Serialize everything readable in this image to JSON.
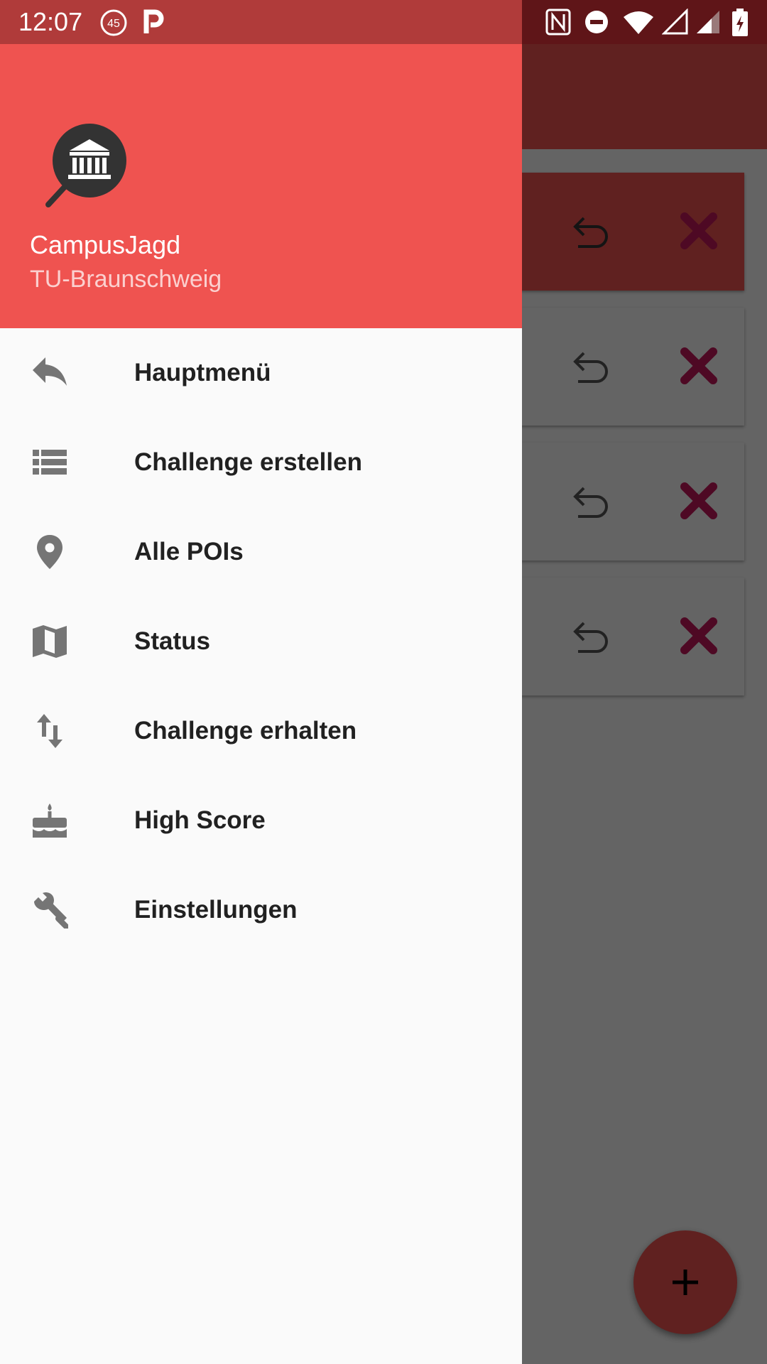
{
  "status_bar": {
    "time": "12:07",
    "notification_badge": "45",
    "icons": [
      "speed-45-icon",
      "parking-p-icon",
      "nfc-icon",
      "do-not-disturb-icon",
      "wifi-icon",
      "signal-empty-icon",
      "signal-icon",
      "battery-charging-icon"
    ]
  },
  "drawer": {
    "app_name": "CampusJagd",
    "subtitle": "TU-Braunschweig",
    "items": [
      {
        "label": "Hauptmenü",
        "icon": "reply-icon"
      },
      {
        "label": "Challenge erstellen",
        "icon": "list-icon"
      },
      {
        "label": "Alle POIs",
        "icon": "location-pin-icon"
      },
      {
        "label": "Status",
        "icon": "map-icon"
      },
      {
        "label": "Challenge erhalten",
        "icon": "swap-vertical-icon"
      },
      {
        "label": "High Score",
        "icon": "cake-icon"
      },
      {
        "label": "Einstellungen",
        "icon": "wrench-icon"
      }
    ]
  },
  "background": {
    "cards": 4,
    "fab_icon": "plus-icon"
  },
  "colors": {
    "primary": "#ef5350",
    "status_bar": "#b03b3a",
    "delete": "#c2185b"
  }
}
